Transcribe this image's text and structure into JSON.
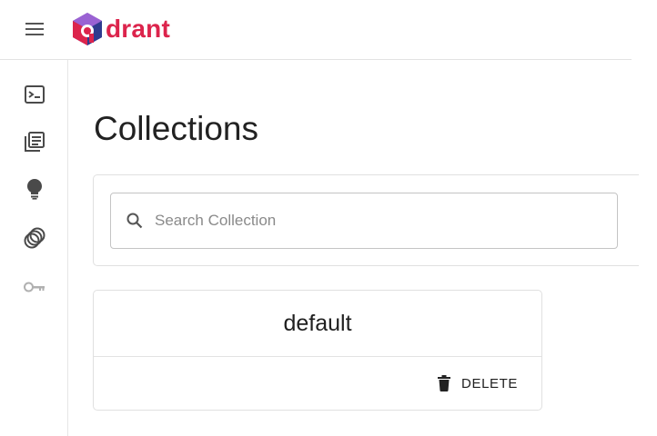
{
  "app": {
    "logo_text": "drant",
    "brand_color": "#dc244c"
  },
  "header": {
    "menu_icon": "hamburger-menu-icon"
  },
  "sidebar": {
    "items": [
      {
        "icon": "console-icon"
      },
      {
        "icon": "collections-icon"
      },
      {
        "icon": "lightbulb-icon"
      },
      {
        "icon": "datasets-icon"
      },
      {
        "icon": "key-icon"
      }
    ]
  },
  "main": {
    "title": "Collections",
    "search": {
      "placeholder": "Search Collection",
      "value": ""
    },
    "collections": [
      {
        "name": "default",
        "delete_label": "DELETE"
      }
    ]
  }
}
